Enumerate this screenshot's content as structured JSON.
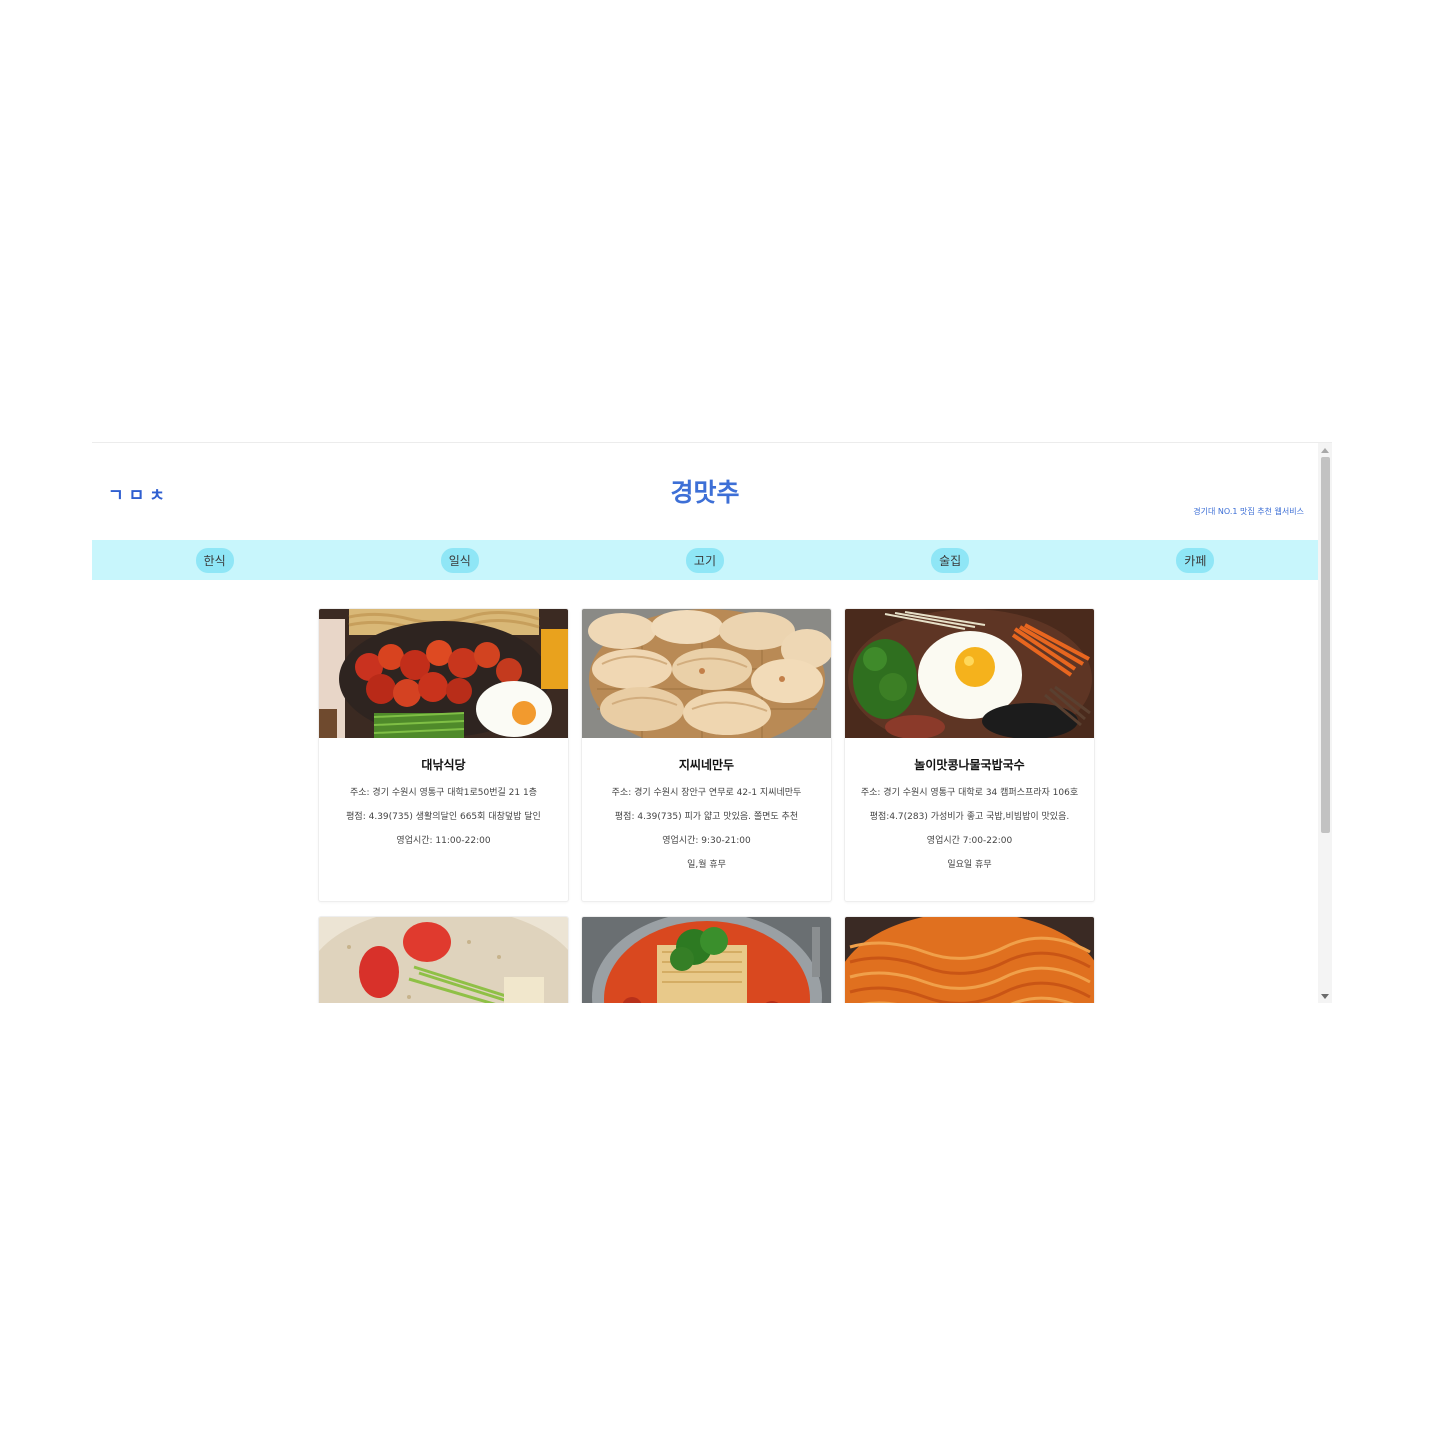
{
  "header": {
    "logo": "ㄱㅁㅊ",
    "title": "경맛추",
    "tagline": "경기대 NO.1 맛집 추천 웹서비스"
  },
  "nav": {
    "items": [
      {
        "label": "한식"
      },
      {
        "label": "일식"
      },
      {
        "label": "고기"
      },
      {
        "label": "술집"
      },
      {
        "label": "카페"
      }
    ]
  },
  "restaurants": [
    {
      "name": "대낚식당",
      "address": "주소: 경기 수원시 영통구 대학1로50번길 21 1층",
      "review": "평점: 4.39(735) 생활의달인 665회 대창덮밥 달인",
      "hours": "영업시간: 11:00-22:00",
      "closed": "",
      "image_icon": "spicy-chicken-bowl-photo"
    },
    {
      "name": "지씨네만두",
      "address": "주소: 경기 수원시 장안구 연무로 42-1 지씨네만두",
      "review": "평점: 4.39(735) 피가 얇고 맛있음. 쫄면도 추천",
      "hours": "영업시간: 9:30-21:00",
      "closed": "일,월 휴무",
      "image_icon": "dumplings-photo"
    },
    {
      "name": "놀이맛콩나물국밥국수",
      "address": "주소: 경기 수원시 영통구 대학로 34 캠퍼스프라자 106호",
      "review": "평점:4.7(283) 가성비가 좋고 국밥,비빔밥이 맛있음.",
      "hours": "영업시간 7:00-22:00",
      "closed": "일요일 휴무",
      "image_icon": "bibimbap-photo"
    },
    {
      "name": "",
      "address": "",
      "review": "",
      "hours": "",
      "closed": "",
      "image_icon": "cold-soy-noodle-photo"
    },
    {
      "name": "",
      "address": "",
      "review": "",
      "hours": "",
      "closed": "",
      "image_icon": "spicy-stew-photo"
    },
    {
      "name": "",
      "address": "",
      "review": "",
      "hours": "",
      "closed": "",
      "image_icon": "spicy-noodle-photo"
    }
  ],
  "colors": {
    "accent": "#3d6fd6",
    "nav_background": "#c8f6fc",
    "nav_button": "#8fe6f6"
  }
}
